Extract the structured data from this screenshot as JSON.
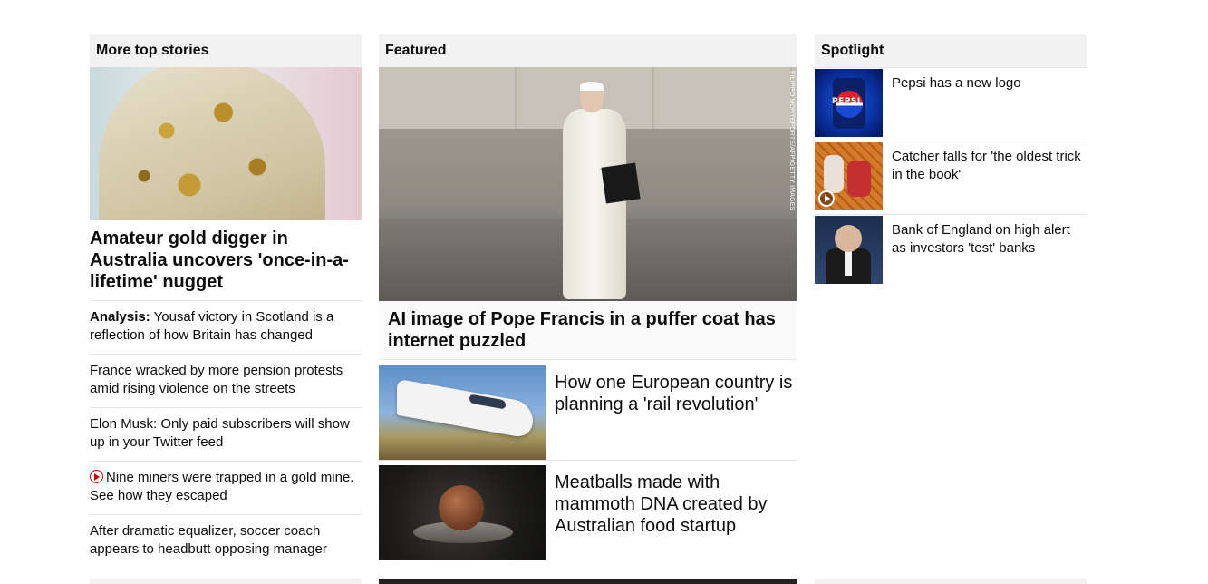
{
  "left": {
    "heading": "More top stories",
    "lead_title": "Amateur gold digger in Australia uncovers 'once-in-a-lifetime' nugget",
    "stories": [
      {
        "prefix": "Analysis:",
        "text": " Yousaf victory in Scotland is a reflection of how Britain has changed"
      },
      {
        "prefix": "",
        "text": "France wracked by more pension protests amid rising violence on the streets"
      },
      {
        "prefix": "",
        "text": "Elon Musk: Only paid subscribers will show up in your Twitter feed"
      },
      {
        "prefix": "",
        "text": "Nine miners were trapped in a gold mine. See how they escaped",
        "video": true
      },
      {
        "prefix": "",
        "text": "After dramatic equalizer, soccer coach appears to headbutt opposing manager"
      }
    ]
  },
  "middle": {
    "heading": "Featured",
    "image_credit": "FILIPPO MONTEFORTE/AFP/GETTY IMAGES",
    "feature_title": "AI image of Pope Francis in a puffer coat has internet puzzled",
    "items": [
      {
        "title": "How one European country is planning a 'rail revolution'"
      },
      {
        "title": "Meatballs made with mammoth DNA created by Australian food startup"
      }
    ]
  },
  "right": {
    "heading": "Spotlight",
    "items": [
      {
        "title": "Pepsi has a new logo",
        "thumb_text": "PEPSI"
      },
      {
        "title": "Catcher falls for 'the oldest trick in the book'",
        "video": true
      },
      {
        "title": "Bank of England on high alert as investors 'test' banks"
      }
    ]
  },
  "colors": {
    "section_header_bg": "#f2f2f2",
    "video_accent": "#cc0000",
    "divider": "#e6e6e6"
  }
}
